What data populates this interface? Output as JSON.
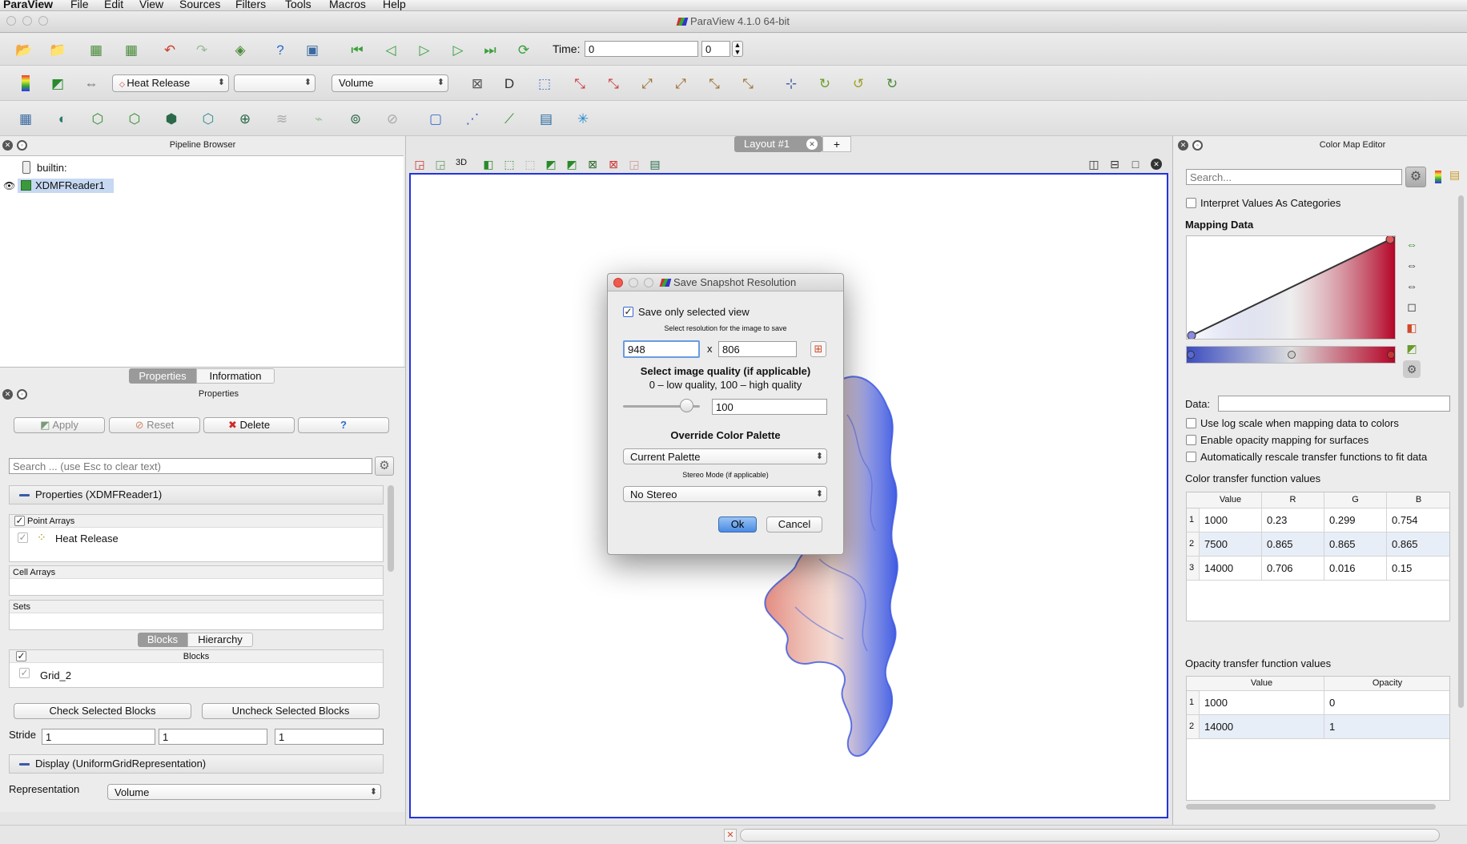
{
  "menu": [
    "ParaView",
    "File",
    "Edit",
    "View",
    "Sources",
    "Filters",
    "Tools",
    "Macros",
    "Help"
  ],
  "window": {
    "title": "ParaView 4.1.0 64-bit"
  },
  "toolbar1": {
    "time_label": "Time:",
    "time_value": "0",
    "timestep_value": "0"
  },
  "toolbar2": {
    "array_combo": "Heat Release",
    "component_combo": "",
    "representation_combo": "Volume"
  },
  "pipeline": {
    "title": "Pipeline Browser",
    "items": [
      {
        "label": "builtin:"
      },
      {
        "label": "XDMFReader1"
      }
    ]
  },
  "tabs": {
    "properties": "Properties",
    "information": "Information"
  },
  "properties": {
    "title": "Properties",
    "apply": "Apply",
    "reset": "Reset",
    "delete": "Delete",
    "help": "?",
    "search_placeholder": "Search ... (use Esc to clear text)",
    "section_reader": "Properties (XDMFReader1)",
    "point_arrays_header": "Point Arrays",
    "point_array_item": "Heat Release",
    "cell_arrays_header": "Cell Arrays",
    "sets_header": "Sets",
    "blocks_tab": "Blocks",
    "hierarchy_tab": "Hierarchy",
    "blocks_header": "Blocks",
    "block_item": "Grid_2",
    "check_selected": "Check Selected Blocks",
    "uncheck_selected": "Uncheck Selected Blocks",
    "stride_label": "Stride",
    "stride_values": [
      "1",
      "1",
      "1"
    ],
    "section_display": "Display (UniformGridRepresentation)",
    "representation_label": "Representation",
    "representation_value": "Volume"
  },
  "layout": {
    "tab_label": "Layout #1",
    "add_tab": "+",
    "view_3d": "3D"
  },
  "dialog": {
    "title": "Save Snapshot Resolution",
    "save_only_selected": "Save only selected view",
    "resolution_caption": "Select resolution for the image to save",
    "width": "948",
    "height": "806",
    "x_symbol": "x",
    "quality_title": "Select image quality (if applicable)",
    "quality_desc": "0 – low quality, 100 – high quality",
    "quality_value": "100",
    "quality_fraction": 1.0,
    "palette_title": "Override Color Palette",
    "palette_value": "Current Palette",
    "stereo_caption": "Stereo Mode (if applicable)",
    "stereo_value": "No Stereo",
    "ok": "Ok",
    "cancel": "Cancel"
  },
  "colormap": {
    "title": "Color Map Editor",
    "search_placeholder": "Search...",
    "interpret_categories": "Interpret Values As Categories",
    "mapping_data": "Mapping Data",
    "data_label": "Data:",
    "log_scale": "Use log scale when mapping data to colors",
    "opacity_mapping": "Enable opacity mapping for surfaces",
    "auto_rescale": "Automatically rescale transfer functions to fit data",
    "ctf_title": "Color transfer function values",
    "ctf_headers": [
      "Value",
      "R",
      "G",
      "B"
    ],
    "ctf_rows": [
      {
        "n": "1",
        "value": "1000",
        "r": "0.23",
        "g": "0.299",
        "b": "0.754"
      },
      {
        "n": "2",
        "value": "7500",
        "r": "0.865",
        "g": "0.865",
        "b": "0.865"
      },
      {
        "n": "3",
        "value": "14000",
        "r": "0.706",
        "g": "0.016",
        "b": "0.15"
      }
    ],
    "otf_title": "Opacity transfer function values",
    "otf_headers": [
      "Value",
      "Opacity"
    ],
    "otf_rows": [
      {
        "n": "1",
        "value": "1000",
        "opacity": "0"
      },
      {
        "n": "2",
        "value": "14000",
        "opacity": "1"
      }
    ]
  },
  "colors": {
    "selection": "#3876d6",
    "cool": "#3b4cc0",
    "warm": "#b40426",
    "view_border": "#2233dd"
  }
}
